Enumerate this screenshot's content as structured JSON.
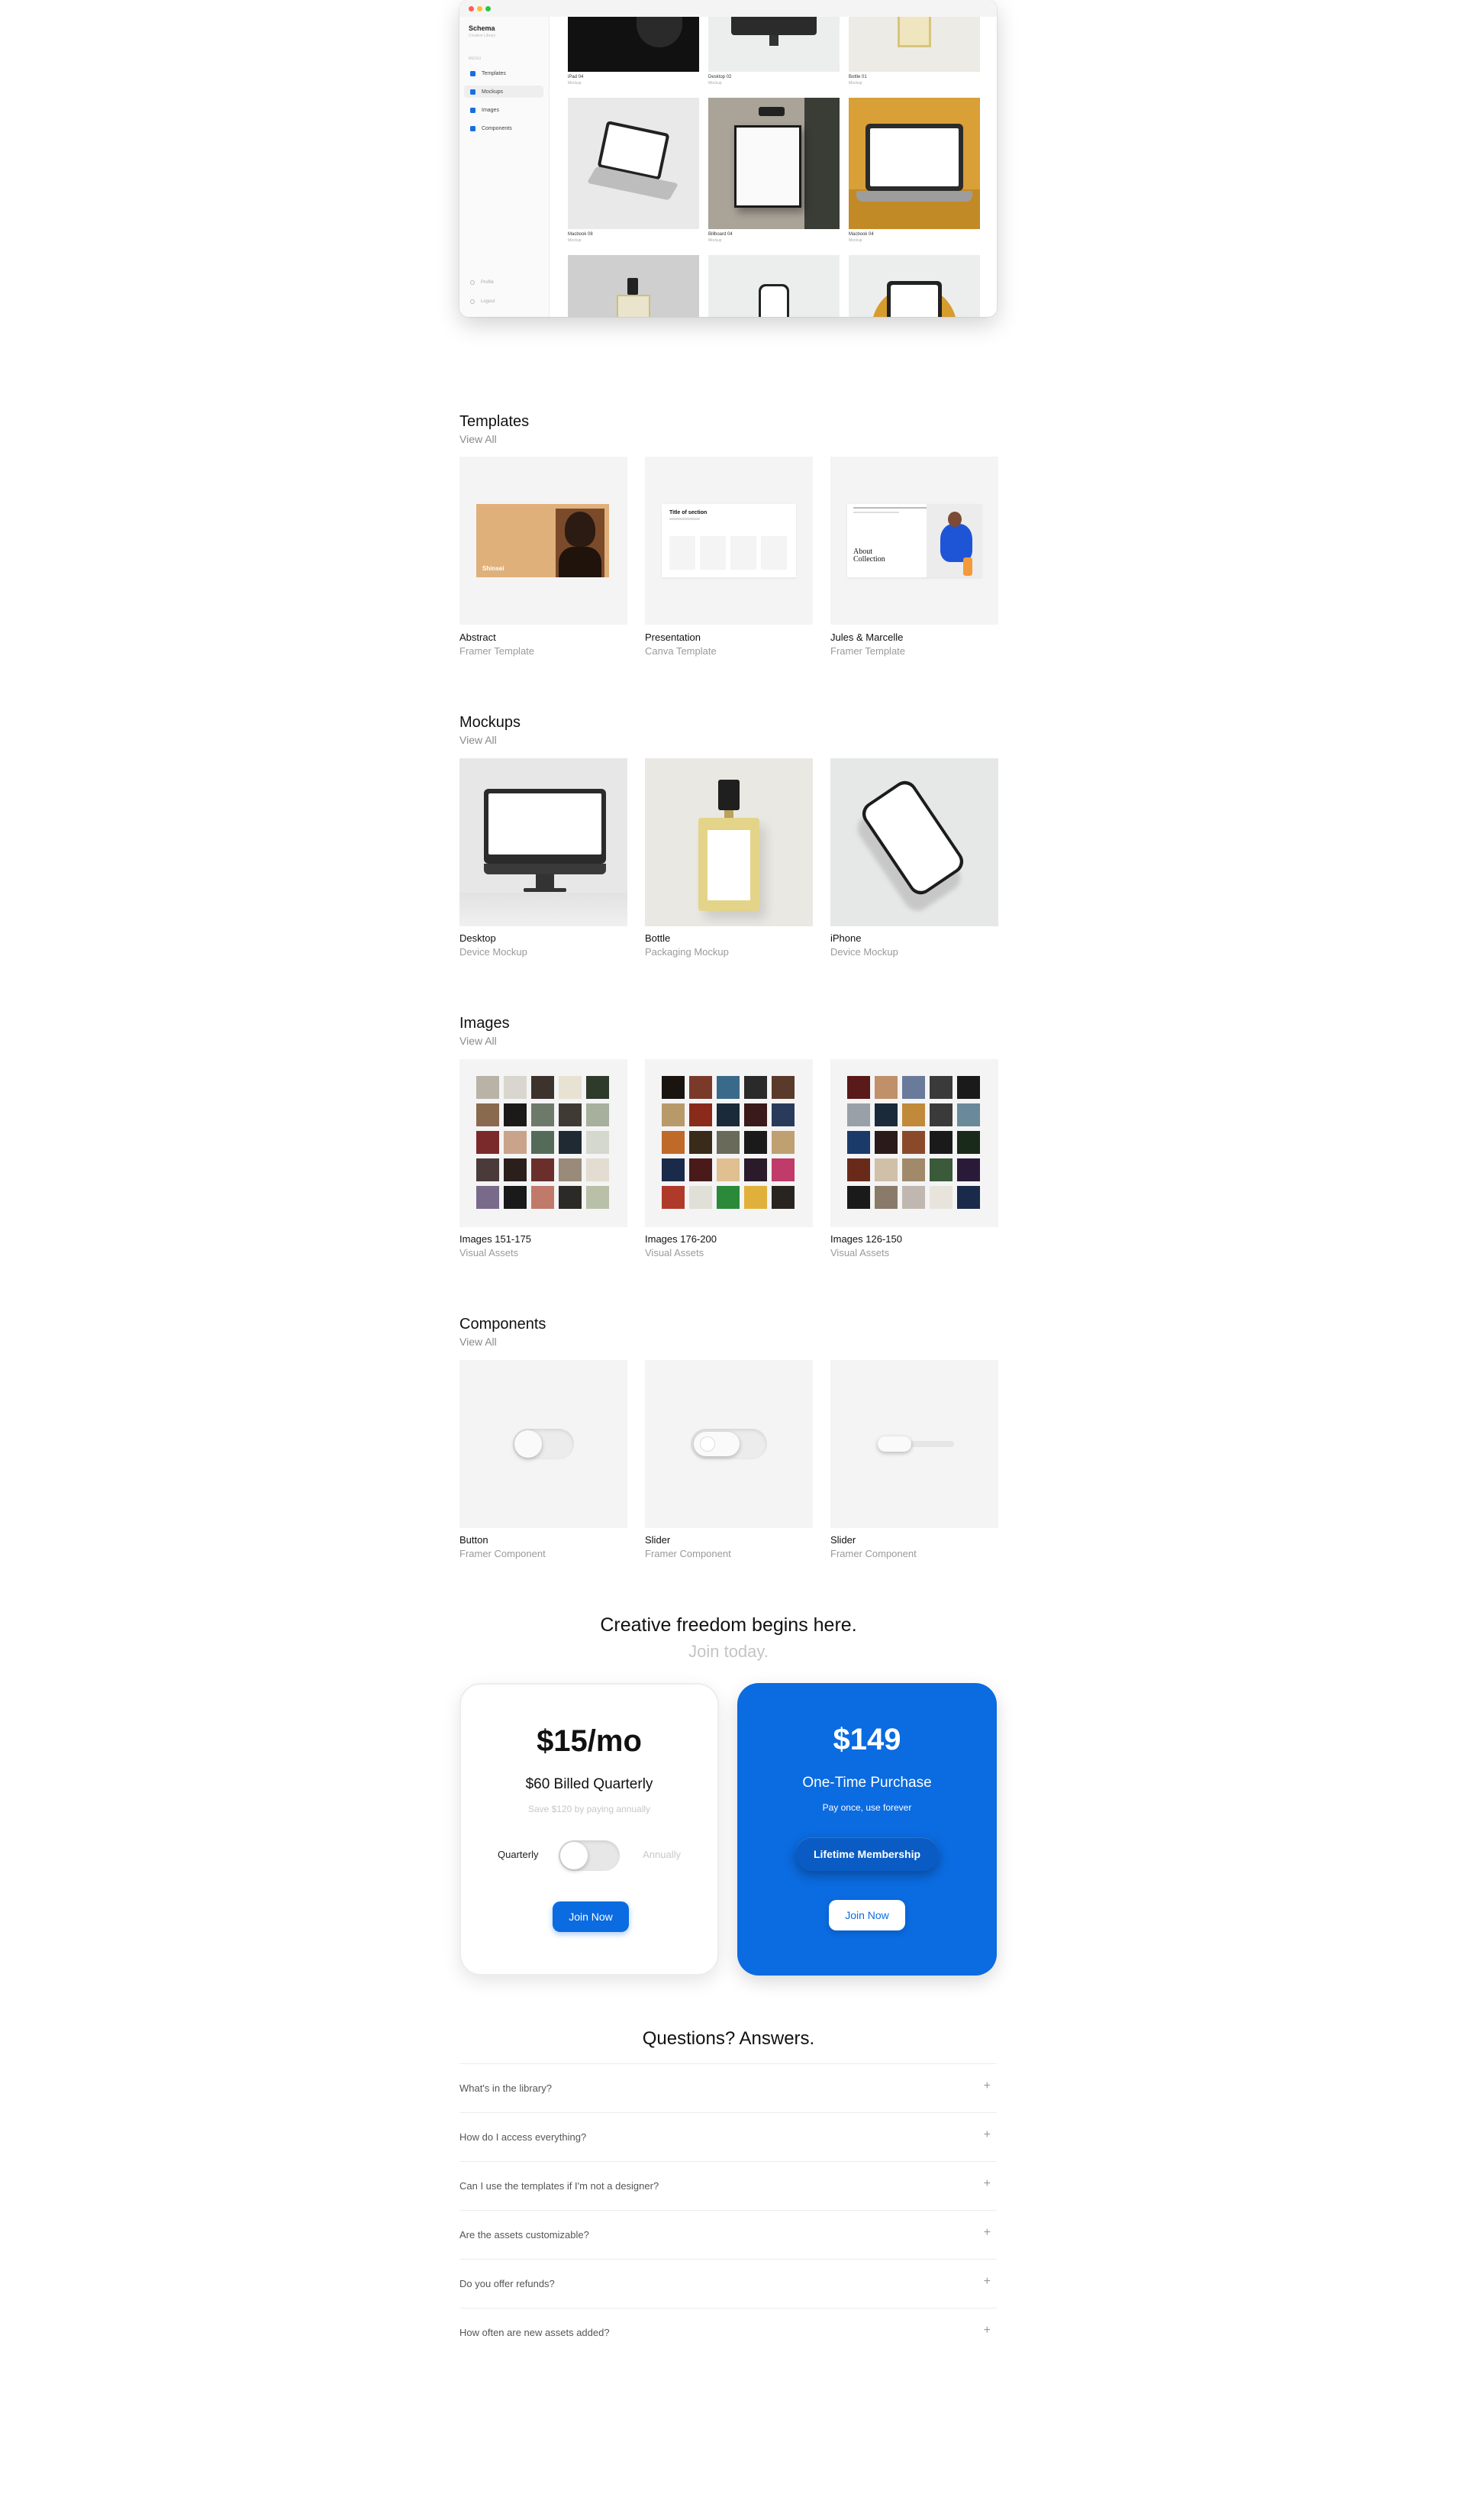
{
  "app": {
    "brand": "Schema",
    "brand_sub": "Creative Library",
    "menu_label": "MENU",
    "nav": [
      {
        "label": "Templates",
        "icon": "template-icon"
      },
      {
        "label": "Mockups",
        "icon": "mockup-icon",
        "active": true
      },
      {
        "label": "Images",
        "icon": "image-icon"
      },
      {
        "label": "Components",
        "icon": "component-icon"
      }
    ],
    "footer": [
      {
        "label": "Profile",
        "icon": "profile-icon"
      },
      {
        "label": "Logout",
        "icon": "logout-icon"
      }
    ],
    "gallery": [
      {
        "title": "iPad 04",
        "sub": "Mockup"
      },
      {
        "title": "Desktop 02",
        "sub": "Mockup"
      },
      {
        "title": "Bottle 01",
        "sub": "Mockup"
      },
      {
        "title": "Macbook 08",
        "sub": "Mockup"
      },
      {
        "title": "Billboard 04",
        "sub": "Mockup"
      },
      {
        "title": "Macbook 04",
        "sub": "Mockup"
      }
    ]
  },
  "sections": {
    "templates": {
      "title": "Templates",
      "view_all": "View All",
      "items": [
        {
          "title": "Abstract",
          "sub": "Framer Template",
          "preview_text": "Shinsei"
        },
        {
          "title": "Presentation",
          "sub": "Canva Template",
          "preview_text": "Title of section"
        },
        {
          "title": "Jules & Marcelle",
          "sub": "Framer Template",
          "preview_text": "About Collection"
        }
      ]
    },
    "mockups": {
      "title": "Mockups",
      "view_all": "View All",
      "items": [
        {
          "title": "Desktop",
          "sub": "Device Mockup"
        },
        {
          "title": "Bottle",
          "sub": "Packaging Mockup"
        },
        {
          "title": "iPhone",
          "sub": "Device Mockup"
        }
      ]
    },
    "images": {
      "title": "Images",
      "view_all": "View All",
      "items": [
        {
          "title": "Images 151-175",
          "sub": "Visual Assets"
        },
        {
          "title": "Images 176-200",
          "sub": "Visual Assets"
        },
        {
          "title": "Images 126-150",
          "sub": "Visual Assets"
        }
      ]
    },
    "components": {
      "title": "Components",
      "view_all": "View All",
      "items": [
        {
          "title": "Button",
          "sub": "Framer Component"
        },
        {
          "title": "Slider",
          "sub": "Framer Component"
        },
        {
          "title": "Slider",
          "sub": "Framer Component"
        }
      ]
    }
  },
  "pricing": {
    "headline": "Creative freedom begins here.",
    "subheadline": "Join today.",
    "plans": [
      {
        "price": "$15/mo",
        "billing": "$60 Billed Quarterly",
        "note": "Save $120 by paying annually",
        "toggle_left": "Quarterly",
        "toggle_right": "Annually",
        "button": "Join Now"
      },
      {
        "price": "$149",
        "billing": "One-Time Purchase",
        "note": "Pay once, use forever",
        "badge": "Lifetime Membership",
        "button": "Join Now"
      }
    ],
    "colors": {
      "accent": "#0b6be0"
    }
  },
  "faq": {
    "title": "Questions? Answers.",
    "items": [
      "What's in the library?",
      "How do I access everything?",
      "Can I use the templates if I'm not a designer?",
      "Are the assets customizable?",
      "Do you offer refunds?",
      "How often are new assets added?"
    ]
  }
}
